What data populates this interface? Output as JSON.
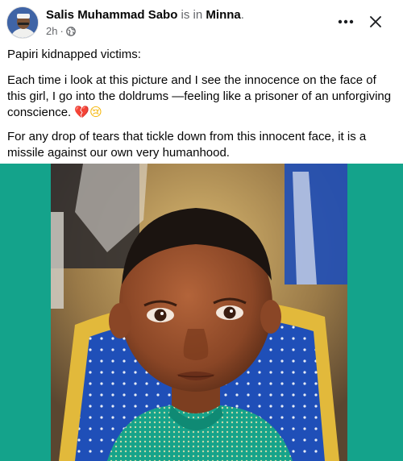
{
  "post": {
    "author": "Salis Muhammad Sabo",
    "is_in": "is in",
    "location": "Minna",
    "period": ".",
    "time": "2h",
    "dot": "·",
    "privacy_icon": "globe-icon",
    "more_icon": "more-horizontal-icon",
    "close_icon": "close-icon",
    "paragraphs": [
      "Papiri kidnapped victims:",
      "Each time i look at this picture and I see the innocence on the face of this girl, I go into the doldrums —feeling like a prisoner of an unforgiving conscience.",
      "For any drop of tears that tickle down from this innocent face, it is a missile against our own very humanhood."
    ],
    "emoji_broken_heart": "💔",
    "emoji_crying": "😢",
    "image_subject": "photo of a young girl seated in a blue chair"
  },
  "colors": {
    "background_panel": "#14a38b",
    "chair_blue": "#1f4fb8",
    "chair_gold": "#e2b93b",
    "text_primary": "#050505",
    "text_secondary": "#65676b"
  }
}
